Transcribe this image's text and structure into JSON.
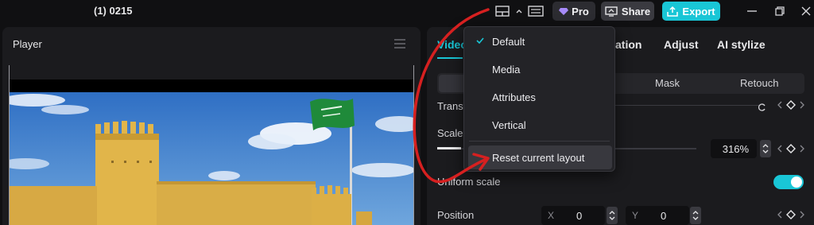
{
  "topbar": {
    "project_title": "(1) 0215",
    "pro_label": "Pro",
    "share_label": "Share",
    "export_label": "Export"
  },
  "player": {
    "title": "Player"
  },
  "right_panel": {
    "tabs": [
      {
        "label": "Video"
      },
      {
        "label": "ation"
      },
      {
        "label": "Adjust"
      },
      {
        "label": "AI stylize"
      }
    ],
    "subtabs": [
      {
        "label": "Mask"
      },
      {
        "label": "Retouch"
      }
    ],
    "transform_label": "Transfo",
    "scale_label": "Scale",
    "scale_value": "316%",
    "uniform_scale_label": "Uniform scale",
    "position_label": "Position",
    "position_x_axis": "X",
    "position_x_value": "0",
    "position_y_axis": "Y",
    "position_y_value": "0"
  },
  "layout_menu": {
    "items": [
      {
        "label": "Default",
        "checked": true
      },
      {
        "label": "Media",
        "checked": false
      },
      {
        "label": "Attributes",
        "checked": false
      },
      {
        "label": "Vertical",
        "checked": false
      }
    ],
    "reset_label": "Reset current layout"
  },
  "colors": {
    "accent": "#19c6d6",
    "annotation": "#d62020",
    "background": "#101012",
    "panel": "#1b1b1e"
  }
}
